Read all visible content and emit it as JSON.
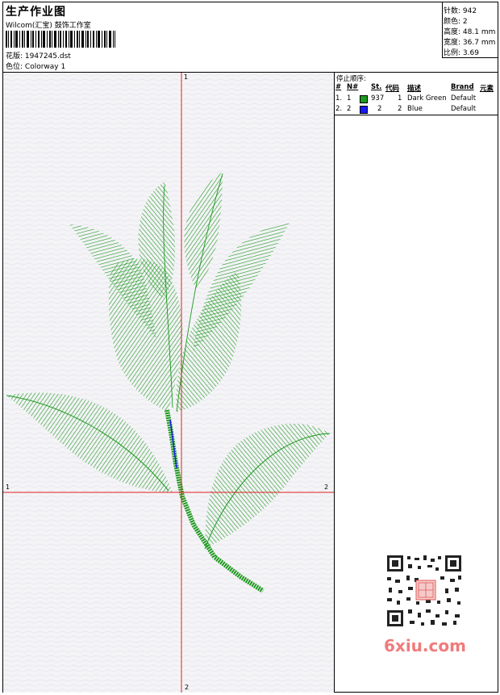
{
  "header": {
    "title": "生产作业图",
    "company": "Wilcom(汇宝) 鼓饰工作室",
    "design_label": "花版:",
    "design_value": "1947245.dst",
    "colorway_label": "色位:",
    "colorway_value": "Colorway 1"
  },
  "stats": {
    "stitches_label": "针数:",
    "stitches_value": "942",
    "colors_label": "颜色:",
    "colors_value": "2",
    "height_label": "高度:",
    "height_value": "48.1 mm",
    "width_label": "宽度:",
    "width_value": "36.7 mm",
    "ratio_label": "比例:",
    "ratio_value": "3.69"
  },
  "stop_sequence": {
    "title": "停止顺序:",
    "columns": [
      "#",
      "N#",
      "St.",
      "代码",
      "描述",
      "Brand",
      "元素"
    ],
    "rows": [
      {
        "num": "1.",
        "n": "1",
        "color": "#1e9a1e",
        "st": "937",
        "code": "1",
        "desc": "Dark Green",
        "brand": "Default"
      },
      {
        "num": "2.",
        "n": "2",
        "color": "#1a1aee",
        "st": "2",
        "code": "2",
        "desc": "Blue",
        "brand": "Default"
      }
    ]
  },
  "axes": {
    "top": "1",
    "bottom": "2",
    "left": "1",
    "right": "2"
  },
  "colors": {
    "thread_green": "#1e9a1e",
    "thread_blue": "#1a1aee",
    "axis_red": "#e02020",
    "watermark": "#f07b7b"
  },
  "watermark": {
    "text": "6xiu.com",
    "seal": "汉字图"
  }
}
